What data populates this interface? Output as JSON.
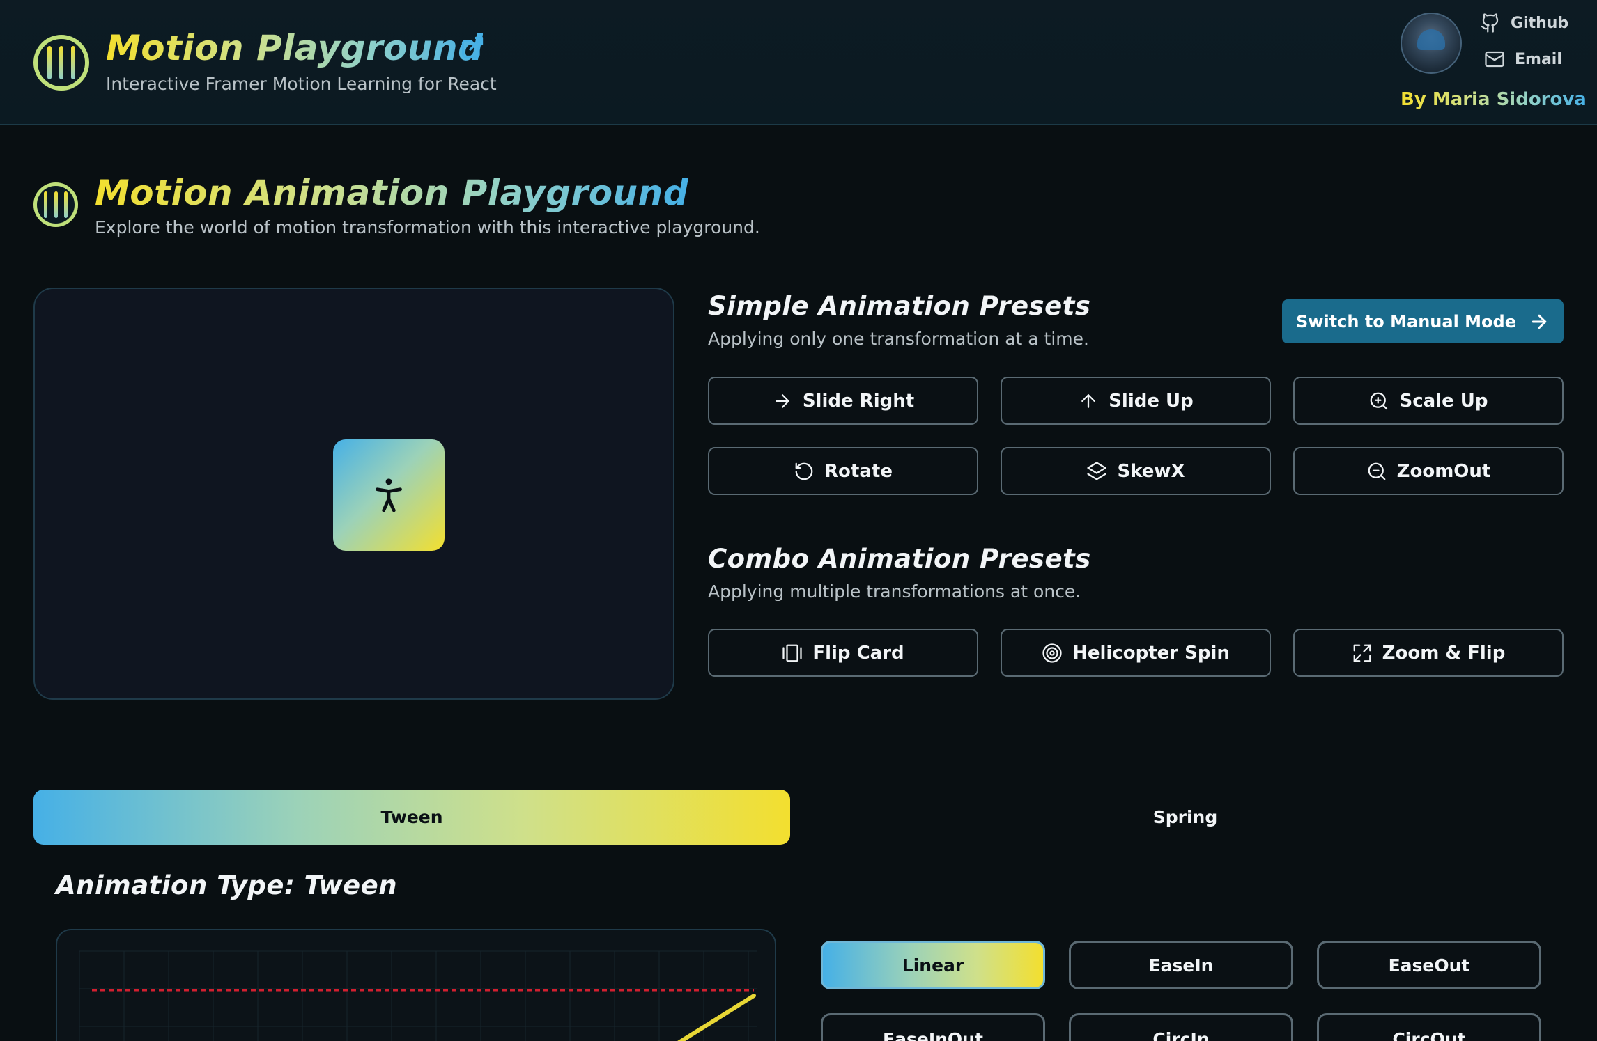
{
  "header": {
    "title": "Motion Playground",
    "subtitle": "Interactive Framer Motion Learning for React",
    "links": [
      {
        "label": "Github",
        "icon": "github-icon"
      },
      {
        "label": "Email",
        "icon": "mail-icon"
      }
    ],
    "byline": "By Maria Sidorova"
  },
  "page": {
    "title": "Motion Animation Playground",
    "description": "Explore the world of motion transformation with this interactive playground."
  },
  "simple": {
    "title": "Simple Animation Presets",
    "subtitle": "Applying only one transformation at a time.",
    "manual_button": "Switch to Manual Mode",
    "presets": [
      {
        "label": "Slide Right",
        "icon": "arrow-right-icon"
      },
      {
        "label": "Slide Up",
        "icon": "arrow-up-icon"
      },
      {
        "label": "Scale Up",
        "icon": "zoom-in-icon"
      },
      {
        "label": "Rotate",
        "icon": "rotate-ccw-icon"
      },
      {
        "label": "SkewX",
        "icon": "layers-icon"
      },
      {
        "label": "ZoomOut",
        "icon": "zoom-out-icon"
      }
    ]
  },
  "combo": {
    "title": "Combo Animation Presets",
    "subtitle": "Applying multiple transformations at once.",
    "presets": [
      {
        "label": "Flip Card",
        "icon": "gallery-icon"
      },
      {
        "label": "Helicopter Spin",
        "icon": "spiral-icon"
      },
      {
        "label": "Zoom & Flip",
        "icon": "expand-icon"
      }
    ]
  },
  "tabs": [
    {
      "label": "Tween",
      "active": true
    },
    {
      "label": "Spring",
      "active": false
    }
  ],
  "animation_type": "Animation Type: Tween",
  "easings": [
    {
      "label": "Linear",
      "active": true
    },
    {
      "label": "EaseIn",
      "active": false
    },
    {
      "label": "EaseOut",
      "active": false
    },
    {
      "label": "EaseInOut",
      "active": false
    },
    {
      "label": "CircIn",
      "active": false
    },
    {
      "label": "CircOut",
      "active": false
    }
  ],
  "colors": {
    "accent_yellow": "#f3df2f",
    "accent_blue": "#46b0e6",
    "primary_button": "#1a6b8c",
    "graph_line": "#e8d735",
    "graph_target": "#d21f2f"
  }
}
